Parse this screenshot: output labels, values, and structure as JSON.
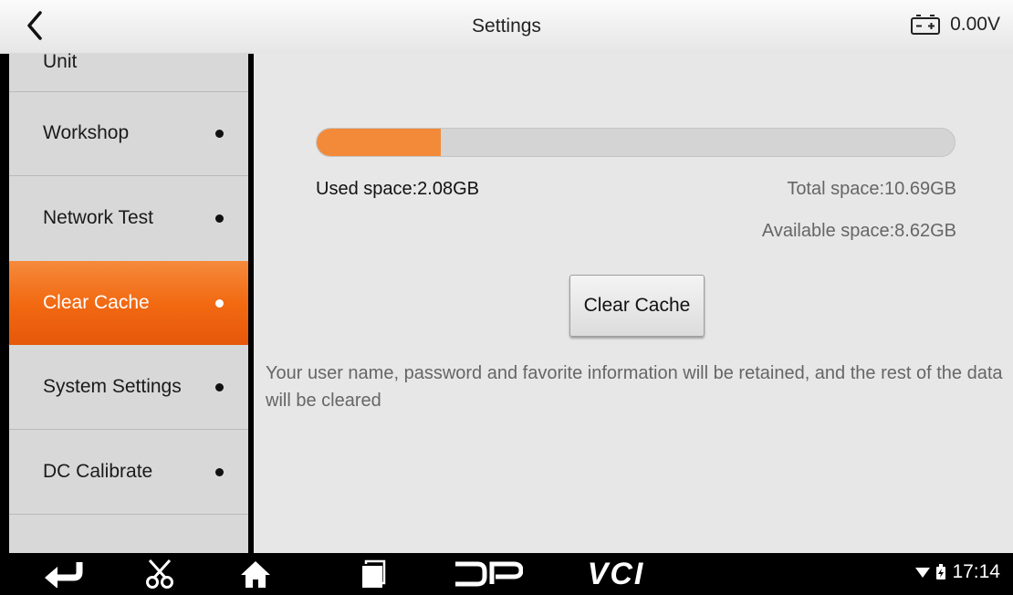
{
  "header": {
    "back_icon": "chevron-left-icon",
    "title": "Settings",
    "battery_icon": "battery-icon",
    "voltage": "0.00V"
  },
  "sidebar": {
    "items": [
      {
        "label": "Unit",
        "active": false
      },
      {
        "label": "Workshop",
        "active": false
      },
      {
        "label": "Network Test",
        "active": false
      },
      {
        "label": "Clear Cache",
        "active": true
      },
      {
        "label": "System Settings",
        "active": false
      },
      {
        "label": "DC Calibrate",
        "active": false
      }
    ]
  },
  "storage": {
    "used_fraction": 0.195,
    "used_label": "Used space:2.08GB",
    "total_label": "Total space:10.69GB",
    "available_label": "Available space:8.62GB",
    "bar_color": "#f28a3a"
  },
  "actions": {
    "clear_cache_label": "Clear Cache"
  },
  "note": "Your user name, password and favorite information will be retained, and the rest of the data will be cleared",
  "navbar": {
    "icons": [
      "back-arrow-icon",
      "scissors-icon",
      "home-icon",
      "recent-apps-icon",
      "dp-logo-icon",
      "vci-logo-icon"
    ],
    "vci_text": "VCI",
    "time": "17:14"
  },
  "colors": {
    "accent": "#f26a12"
  }
}
